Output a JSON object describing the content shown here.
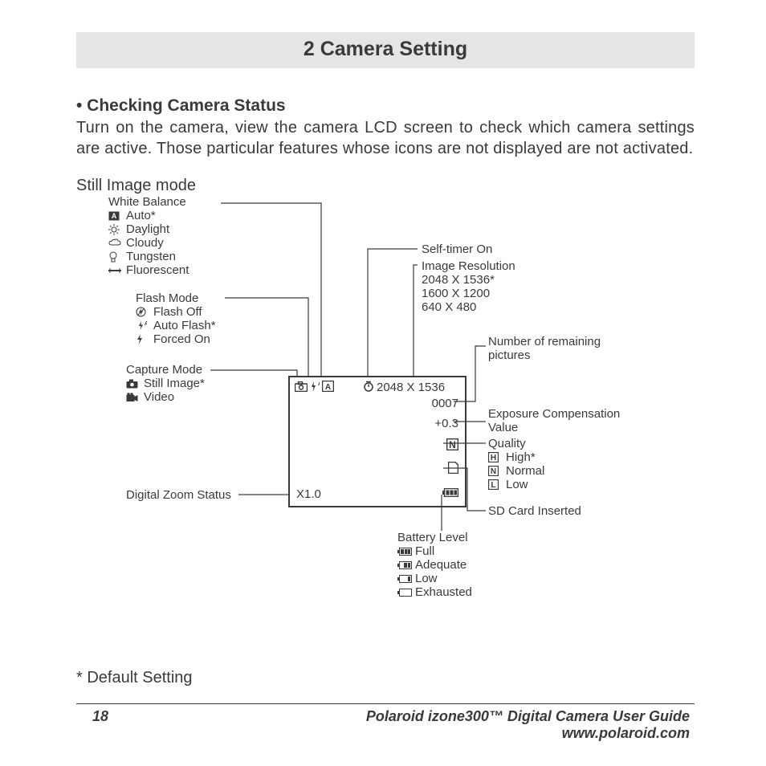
{
  "title": "2 Camera Setting",
  "section": "• Checking Camera Status",
  "paragraph": "Turn on the camera, view the camera LCD screen to check which camera settings are active. Those particular features whose icons are not displayed are not activated.",
  "mode_head": "Still Image mode",
  "white_balance": {
    "title": "White Balance",
    "items": [
      "Auto*",
      "Daylight",
      "Cloudy",
      "Tungsten",
      "Fluorescent"
    ]
  },
  "flash_mode": {
    "title": "Flash Mode",
    "items": [
      "Flash Off",
      "Auto Flash*",
      "Forced On"
    ]
  },
  "capture_mode": {
    "title": "Capture Mode",
    "items": [
      "Still Image*",
      "Video"
    ]
  },
  "digital_zoom": {
    "label": "Digital Zoom Status",
    "value": "X1.0"
  },
  "self_timer": "Self-timer On",
  "image_res": {
    "title": "Image Resolution",
    "items": [
      "2048 X 1536*",
      "1600 X 1200",
      "640 X 480"
    ]
  },
  "remaining": {
    "label": "Number of remaining pictures"
  },
  "ev": {
    "label": "Exposure Compensation Value"
  },
  "quality": {
    "title": "Quality",
    "items": [
      "High*",
      "Normal",
      "Low"
    ],
    "letters": [
      "H",
      "N",
      "L"
    ]
  },
  "sd": "SD Card Inserted",
  "battery": {
    "title": "Battery Level",
    "items": [
      "Full",
      "Adequate",
      "Low",
      "Exhausted"
    ]
  },
  "lcd": {
    "res": "2048 X 1536",
    "count": "0007",
    "ev": "+0.3",
    "zoom": "X1.0",
    "quality_letter": "N"
  },
  "footnote": "* Default Setting",
  "footer": {
    "page": "18",
    "guide": "Polaroid izone300™ Digital Camera User Guide",
    "url": "www.polaroid.com"
  }
}
